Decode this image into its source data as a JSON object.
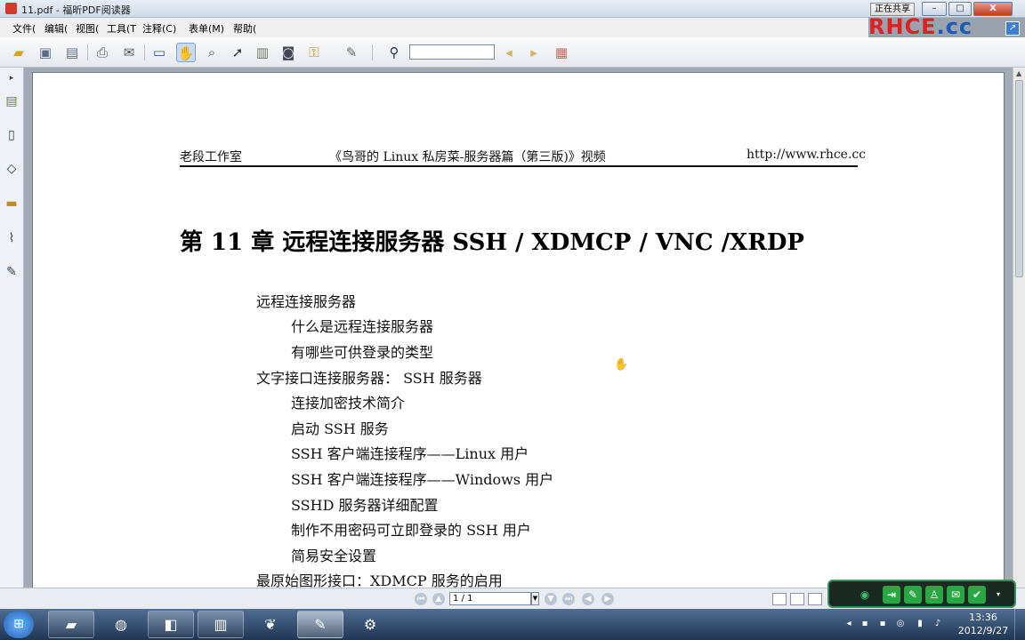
{
  "window": {
    "title": "11.pdf - 福昕PDF阅读器",
    "share_label": "正在共享",
    "min_label": "–",
    "max_label": "□",
    "close_label": "X"
  },
  "logo": {
    "text_main": "RHCE",
    "text_dot": ".cc"
  },
  "menu": [
    "文件(",
    "编辑(",
    "视图(",
    "工具(T",
    "注释(C)",
    "表单(M)",
    "帮助("
  ],
  "toolbar": {
    "find_placeholder": ""
  },
  "document": {
    "header_left": "老段工作室",
    "header_center": "《鸟哥的 Linux 私房菜-服务器篇（第三版)》视频",
    "header_right": "http://www.rhce.cc",
    "chapter_title": "第 11 章  远程连接服务器  SSH / XDMCP / VNC /XRDP",
    "toc": [
      {
        "level": 1,
        "text": "远程连接服务器"
      },
      {
        "level": 2,
        "text": "什么是远程连接服务器"
      },
      {
        "level": 2,
        "text": "有哪些可供登录的类型"
      },
      {
        "level": 1,
        "text": "文字接口连接服务器：  SSH  服务器"
      },
      {
        "level": 2,
        "text": "连接加密技术简介"
      },
      {
        "level": 2,
        "text": "启动  SSH  服务"
      },
      {
        "level": 2,
        "text": "SSH  客户端连接程序——Linux  用户"
      },
      {
        "level": 2,
        "text": "SSH  客户端连接程序——Windows  用户"
      },
      {
        "level": 2,
        "text": "SSHD  服务器详细配置"
      },
      {
        "level": 2,
        "text": "制作不用密码可立即登录的 SSH 用户"
      },
      {
        "level": 2,
        "text": "简易安全设置"
      },
      {
        "level": 1,
        "text": "最原始图形接口：XDMCP 服务的启用"
      }
    ]
  },
  "status": {
    "page_value": "1 / 1"
  },
  "taskbar": {
    "time": "13:36",
    "date": "2012/9/27"
  },
  "colors": {
    "logo_red": "#e02020",
    "logo_blue": "#1d5ab8",
    "widget_green": "#28a745"
  }
}
